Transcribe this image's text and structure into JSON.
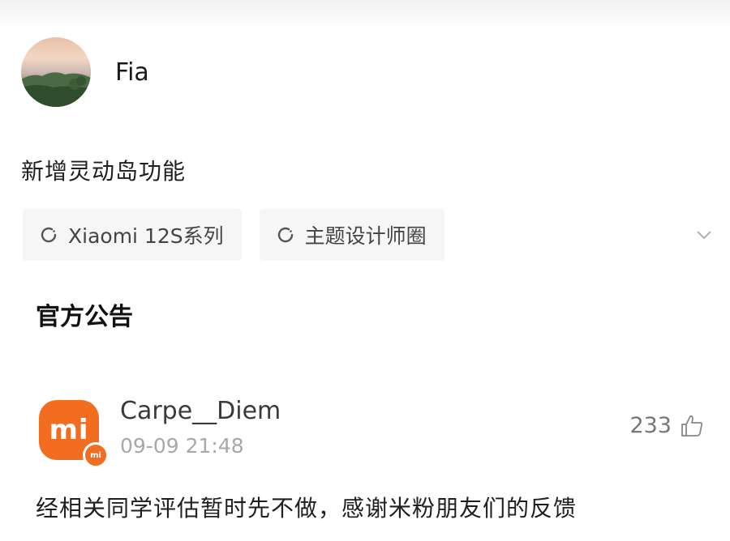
{
  "post": {
    "author": "Fia",
    "text": "新增灵动岛功能",
    "topics": [
      {
        "label": "Xiaomi 12S系列",
        "icon": "topic-circle-icon"
      },
      {
        "label": "主题设计师圈",
        "icon": "topic-circle-icon"
      }
    ]
  },
  "section": {
    "title": "官方公告"
  },
  "comment": {
    "username": "Carpe__Diem",
    "time": "09-09 21:48",
    "likes": "233",
    "text": "经相关同学评估暂时先不做，感谢米粉朋友们的反馈",
    "avatar_logo": "mi",
    "badge_logo": "mi"
  },
  "colors": {
    "brand": "#f36d20",
    "chip_bg": "#f6f6f6",
    "muted": "#a8a8a8"
  }
}
